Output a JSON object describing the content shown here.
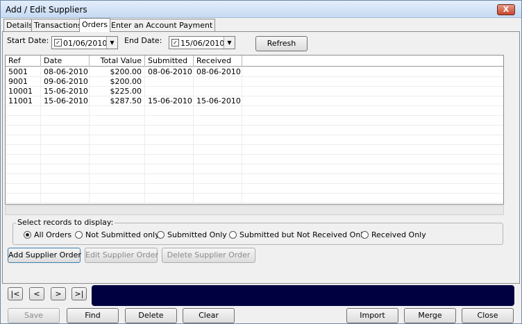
{
  "window": {
    "title": "Add / Edit Suppliers",
    "close_glyph": "X"
  },
  "tabs": [
    {
      "label": "Details"
    },
    {
      "label": "Transactions"
    },
    {
      "label": "Orders"
    },
    {
      "label": "Enter an Account Payment"
    }
  ],
  "filter": {
    "start_label": "Start Date:",
    "start_value": "01/06/2010",
    "end_label": "End Date:",
    "end_value": "15/06/2010",
    "refresh_label": "Refresh"
  },
  "grid": {
    "columns": [
      "Ref",
      "Date",
      "Total Value",
      "Submitted",
      "Received"
    ],
    "rows": [
      [
        "5001",
        "08-06-2010",
        "$200.00",
        "08-06-2010",
        "08-06-2010"
      ],
      [
        "9001",
        "09-06-2010",
        "$200.00",
        "",
        ""
      ],
      [
        "10001",
        "15-06-2010",
        "$225.00",
        "",
        ""
      ],
      [
        "11001",
        "15-06-2010",
        "$287.50",
        "15-06-2010",
        "15-06-2010"
      ]
    ]
  },
  "records": {
    "legend": "Select records to display:",
    "options": [
      {
        "label": "All Orders",
        "checked": true
      },
      {
        "label": "Not Submitted only",
        "checked": false
      },
      {
        "label": "Submitted Only",
        "checked": false
      },
      {
        "label": "Submitted but Not Received Only",
        "checked": false
      },
      {
        "label": "Received Only",
        "checked": false
      }
    ]
  },
  "order_buttons": {
    "add": "Add Supplier Order",
    "edit": "Edit Supplier Order",
    "delete": "Delete Supplier Order"
  },
  "nav": {
    "first": "|<",
    "prev": "<",
    "next": ">",
    "last": ">|"
  },
  "bottom": {
    "save": "Save",
    "find": "Find",
    "delete": "Delete",
    "clear": "Clear",
    "import": "Import",
    "merge": "Merge",
    "close": "Close"
  },
  "colors": {
    "status_bar": "#000040",
    "title_bar": "#c6daf2"
  }
}
